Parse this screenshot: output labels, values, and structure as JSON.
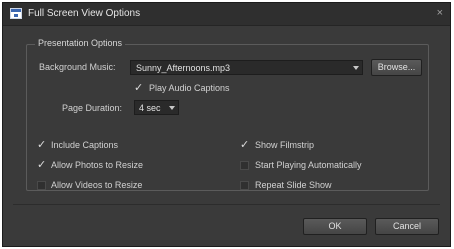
{
  "window": {
    "title": "Full Screen View Options",
    "close_glyph": "×",
    "app_icon": "slideshow-window-icon"
  },
  "presentation": {
    "group_title": "Presentation Options",
    "background_music": {
      "label": "Background Music:",
      "value": "Sunny_Afternoons.mp3"
    },
    "browse_label": "Browse...",
    "play_audio_captions": {
      "label": "Play Audio Captions",
      "checked": true
    },
    "page_duration": {
      "label": "Page Duration:",
      "value": "4 sec"
    }
  },
  "options": [
    {
      "label": "Include Captions",
      "checked": true
    },
    {
      "label": "Allow Photos to Resize",
      "checked": true
    },
    {
      "label": "Allow Videos to Resize",
      "checked": false
    },
    {
      "label": "Show Filmstrip",
      "checked": true
    },
    {
      "label": "Start Playing Automatically",
      "checked": false
    },
    {
      "label": "Repeat Slide Show",
      "checked": false
    }
  ],
  "footer": {
    "ok_label": "OK",
    "cancel_label": "Cancel"
  }
}
